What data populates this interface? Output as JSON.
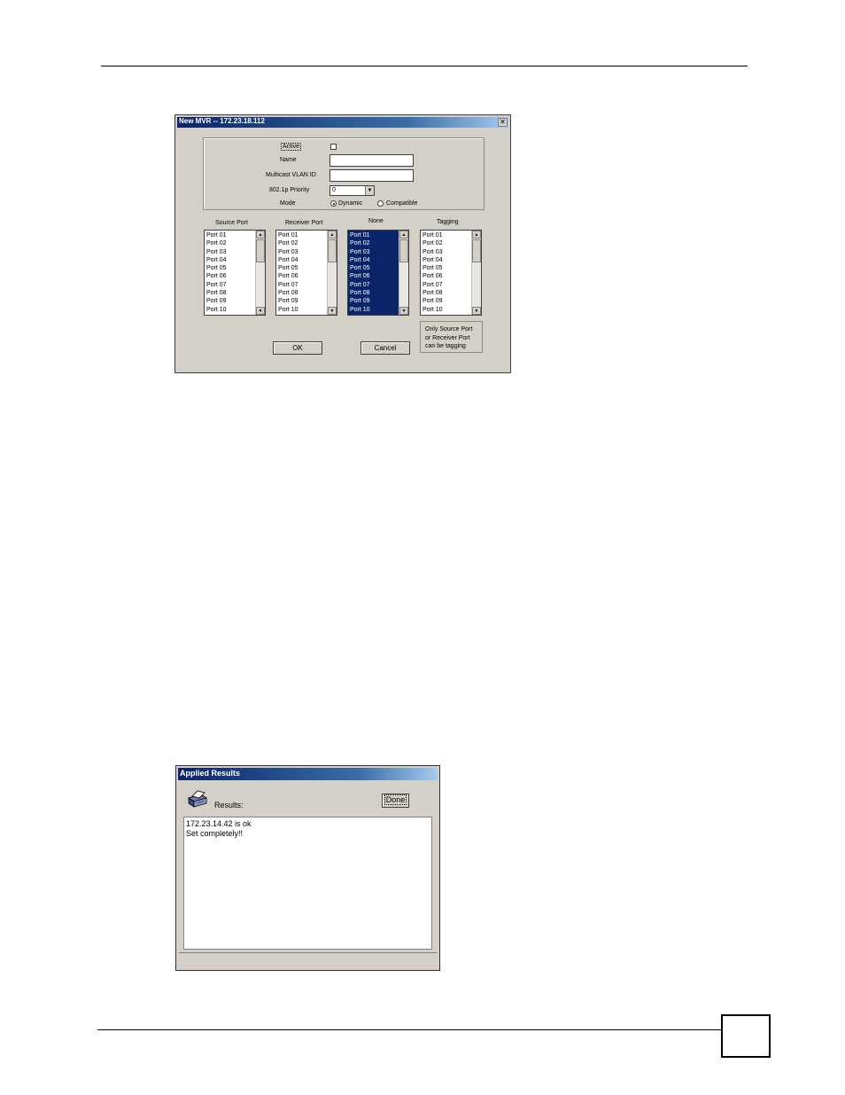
{
  "mvr_dialog": {
    "title": "New MVR -- 172.23.18.112",
    "close_glyph": "✕",
    "active_label": "Active",
    "name_label": "Name",
    "name_value": "",
    "vlan_label": "Multicast VLAN ID",
    "vlan_value": "",
    "priority_label": "802.1p Priority",
    "priority_value": "0",
    "mode_label": "Mode",
    "mode_options": [
      "Dynamic",
      "Compatible"
    ],
    "mode_selected": "Dynamic",
    "columns": [
      "Source Port",
      "Receiver Port",
      "None",
      "Tagging"
    ],
    "ports": [
      "Port 01",
      "Port 02",
      "Port 03",
      "Port 04",
      "Port 05",
      "Port 06",
      "Port 07",
      "Port 08",
      "Port 09",
      "Port 10"
    ],
    "ok_label": "OK",
    "cancel_label": "Cancel",
    "note_lines": [
      "Only Source Port",
      "or Receiver Port",
      "can be tagging"
    ],
    "title_bar_color": "#0a246a",
    "selected_list_color": "#0a246a"
  },
  "results_dialog": {
    "title": "Applied Results",
    "results_label": "Results:",
    "done_label": "Done",
    "lines": [
      "172.23.14.42 is ok",
      "Set completely!!"
    ],
    "icon": "printer-icon"
  }
}
